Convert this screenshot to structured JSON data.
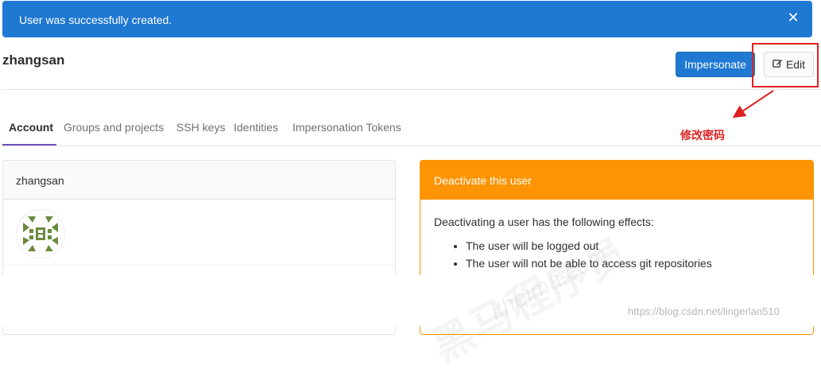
{
  "flash": {
    "message": "User was successfully created.",
    "close_glyph": "✕"
  },
  "header": {
    "username": "zhangsan",
    "impersonate_label": "Impersonate",
    "edit_label": "Edit"
  },
  "annotation": {
    "text": "修改密码",
    "color": "#e02020"
  },
  "tabs": [
    {
      "label": "Account",
      "active": true
    },
    {
      "label": "Groups and projects",
      "active": false
    },
    {
      "label": "SSH keys",
      "active": false
    },
    {
      "label": "Identities",
      "active": false
    },
    {
      "label": "Impersonation Tokens",
      "active": false
    }
  ],
  "profile_card": {
    "title": "zhangsan",
    "avatar_icon": "identicon-avatar"
  },
  "deactivate_card": {
    "title": "Deactivate this user",
    "description": "Deactivating a user has the following effects:",
    "effects": [
      "The user will be logged out",
      "The user will not be able to access git repositories"
    ]
  },
  "watermark": {
    "brand_cn": "黑马程序员",
    "brand_en": "itheima.com",
    "url": "https://blog.csdn.net/lingerlan510"
  },
  "colors": {
    "primary": "#1f78d1",
    "warning": "#fc9403",
    "tab_active": "#6b4fbb",
    "avatar": "#6a8a3d"
  }
}
